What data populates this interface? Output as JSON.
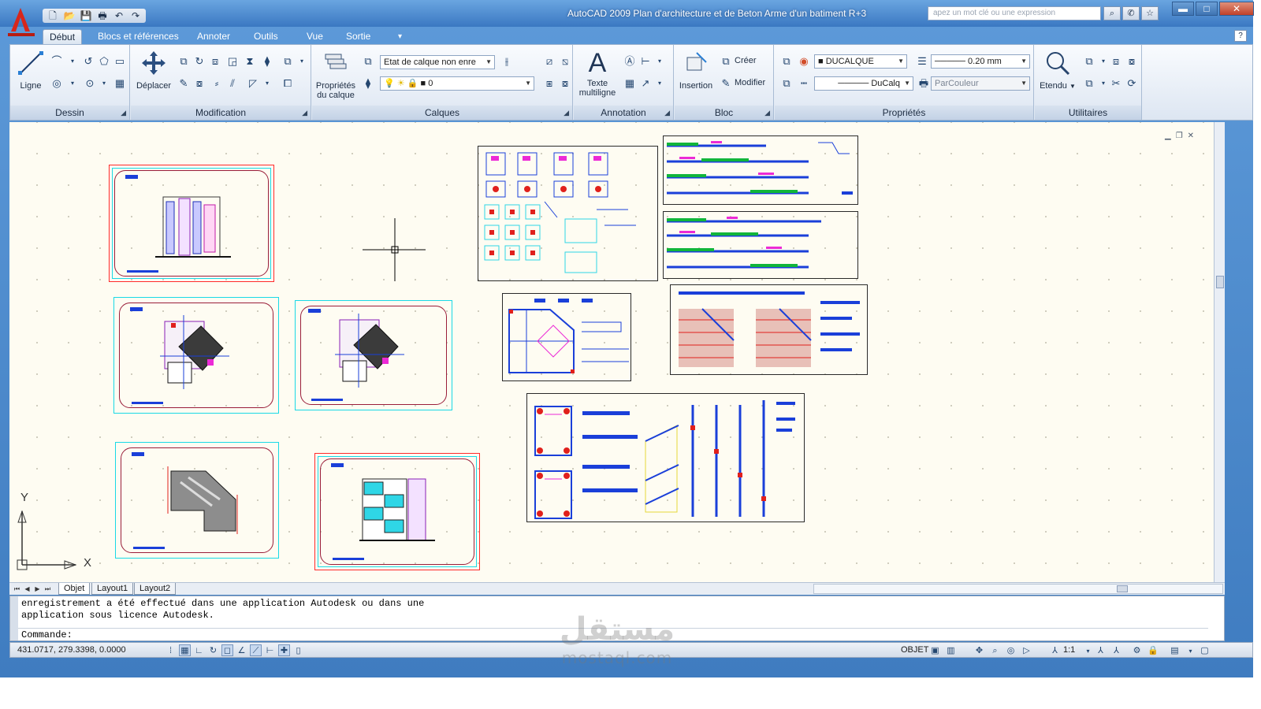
{
  "window": {
    "title": "AutoCAD 2009 Plan d'architecture et de Beton Arme d'un batiment R+3",
    "search_placeholder": "apez un mot clé ou une expression",
    "controls": {
      "minimize": "▬",
      "maximize": "□",
      "close": "✕"
    }
  },
  "quick_access": {
    "icons": [
      "new-icon",
      "open-icon",
      "save-icon",
      "print-icon",
      "undo-icon",
      "redo-icon"
    ],
    "glyphs": [
      "🗋",
      "📂",
      "💾",
      "🖶",
      "↶",
      "↷"
    ]
  },
  "ribbon_tabs": [
    "Début",
    "Blocs et références",
    "Annoter",
    "Outils",
    "Vue",
    "Sortie"
  ],
  "ribbon_tabs_more": "▾",
  "help": "?",
  "panels": {
    "dessin": {
      "label": "Dessin",
      "big_tool": "Ligne"
    },
    "modification": {
      "label": "Modification",
      "big_tool": "Déplacer"
    },
    "calques": {
      "label": "Calques",
      "big_tool_line1": "Propriétés",
      "big_tool_line2": "du calque",
      "layer_state": "Etat de calque non enre",
      "current_layer": "0"
    },
    "annotation": {
      "label": "Annotation",
      "big_tool_line1": "Texte",
      "big_tool_line2": "multiligne",
      "big_glyph": "A"
    },
    "bloc": {
      "label": "Bloc",
      "big_tool": "Insertion",
      "create": "Créer",
      "modify": "Modifier"
    },
    "proprietes": {
      "label": "Propriétés",
      "color": "DUCALQUE",
      "lineweight": "0.20 mm",
      "linetype": "DuCalq",
      "plotstyle": "ParCouleur"
    },
    "utilitaires": {
      "label": "Utilitaires",
      "big_tool": "Etendu"
    }
  },
  "layout_tabs": [
    "Objet",
    "Layout1",
    "Layout2"
  ],
  "command": {
    "history": [
      "enregistrement a été effectué dans une application Autodesk ou dans une",
      "application sous licence Autodesk."
    ],
    "prompt": "Commande:"
  },
  "status": {
    "coords": "431.0717, 279.3398, 0.0000",
    "model_label": "OBJET",
    "scale": "1:1"
  },
  "ucs": {
    "x_label": "X",
    "y_label": "Y"
  },
  "watermark": {
    "arabic": "مستقل",
    "latin": "mostaql.com"
  },
  "colors": {
    "canvas": "#fefcf2",
    "sheet_red": "#ff2a2a",
    "sheet_cyan": "#19d9e6",
    "frame_blue": "#3f7cc0"
  }
}
